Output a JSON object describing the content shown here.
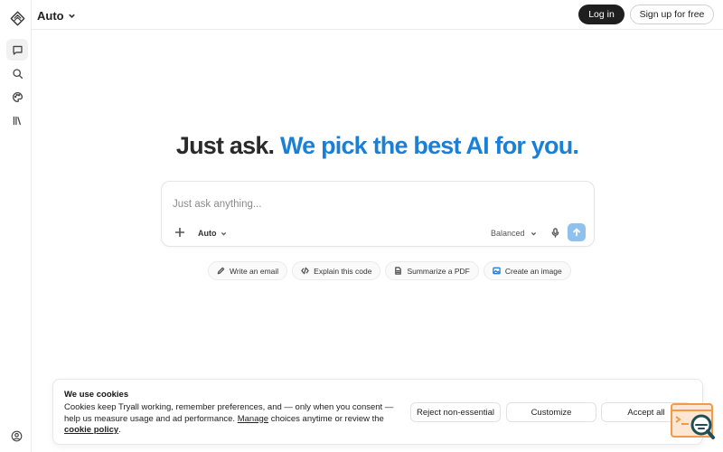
{
  "header": {
    "model_label": "Auto",
    "login_label": "Log in",
    "signup_label": "Sign up for free"
  },
  "sidebar": {
    "items": [
      {
        "icon": "chat-icon"
      },
      {
        "icon": "search-icon"
      },
      {
        "icon": "palette-icon"
      },
      {
        "icon": "library-icon"
      }
    ]
  },
  "hero": {
    "headline_dark": "Just ask.",
    "headline_blue": "We pick the best AI for you."
  },
  "prompt": {
    "placeholder": "Just ask anything...",
    "model_label": "Auto",
    "mode_label": "Balanced"
  },
  "chips": [
    {
      "label": "Write an email",
      "icon": "pencil-icon"
    },
    {
      "label": "Explain this code",
      "icon": "code-icon"
    },
    {
      "label": "Summarize a PDF",
      "icon": "document-icon"
    },
    {
      "label": "Create an image",
      "icon": "image-icon"
    }
  ],
  "cookie": {
    "title": "We use cookies",
    "text_1": "Cookies keep Tryall working, remember preferences, and — only when you consent — help us measure usage and ad performance.",
    "manage": "Manage",
    "text_2": " choices anytime or review the ",
    "policy": "cookie policy",
    "text_3": ".",
    "reject_label": "Reject non-essential",
    "customize_label": "Customize",
    "accept_label": "Accept all"
  },
  "colors": {
    "accent_blue": "#1a7fd6",
    "send_button": "#8fc1ef",
    "login_button": "#1f1f1f",
    "widget_orange": "#f29a4a",
    "widget_teal": "#1f4e57"
  }
}
